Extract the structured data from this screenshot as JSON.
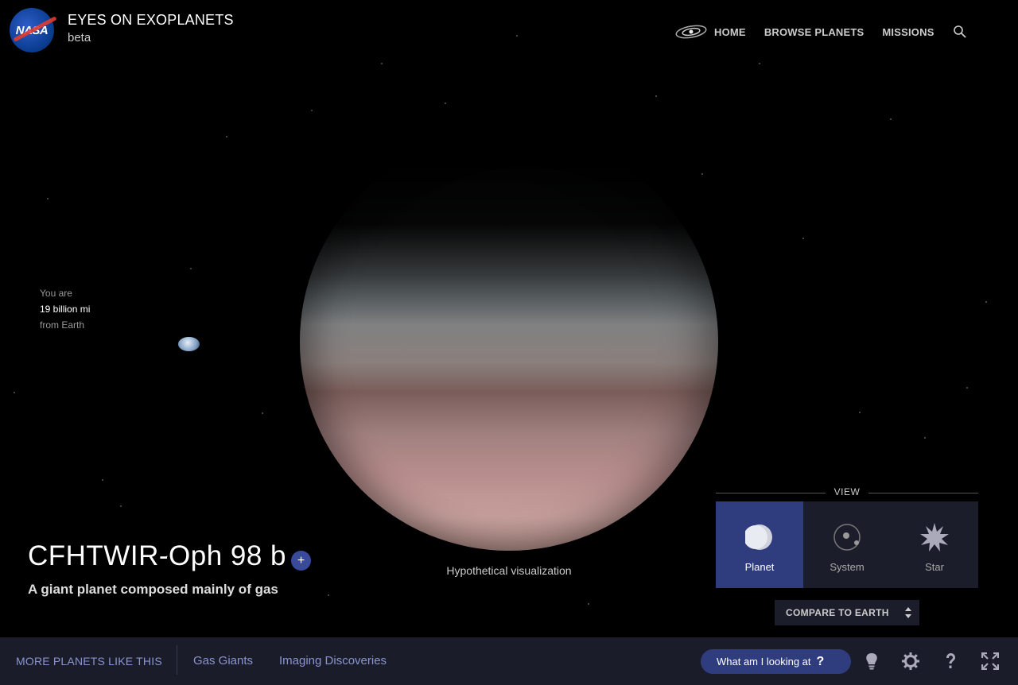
{
  "header": {
    "logo_text": "NASA",
    "title": "EYES ON EXOPLANETS",
    "subtitle": "beta",
    "nav": [
      {
        "label": "HOME",
        "icon": "galaxy-icon"
      },
      {
        "label": "BROWSE PLANETS"
      },
      {
        "label": "MISSIONS"
      }
    ],
    "search_icon": "search-icon"
  },
  "distance": {
    "prefix": "You are",
    "value": "19 billion mi",
    "suffix": "from Earth"
  },
  "planet": {
    "name": "CFHTWIR-Oph 98 b",
    "add_symbol": "+",
    "description": "A giant planet composed mainly of gas",
    "caption": "Hypothetical visualization"
  },
  "view": {
    "label": "VIEW",
    "options": [
      {
        "label": "Planet",
        "icon": "planet-icon",
        "active": true
      },
      {
        "label": "System",
        "icon": "system-icon",
        "active": false
      },
      {
        "label": "Star",
        "icon": "star-icon",
        "active": false
      }
    ],
    "compare_label": "COMPARE TO EARTH"
  },
  "bottom": {
    "more_label": "MORE PLANETS LIKE THIS",
    "links": [
      "Gas Giants",
      "Imaging Discoveries"
    ],
    "what_label": "What am I looking at",
    "what_symbol": "?",
    "tools": [
      "lightbulb-icon",
      "settings-icon",
      "help-icon",
      "fullscreen-icon"
    ]
  },
  "colors": {
    "accent": "#2f3d7e",
    "panel": "#1b1d2b",
    "link": "#8a95d0"
  }
}
